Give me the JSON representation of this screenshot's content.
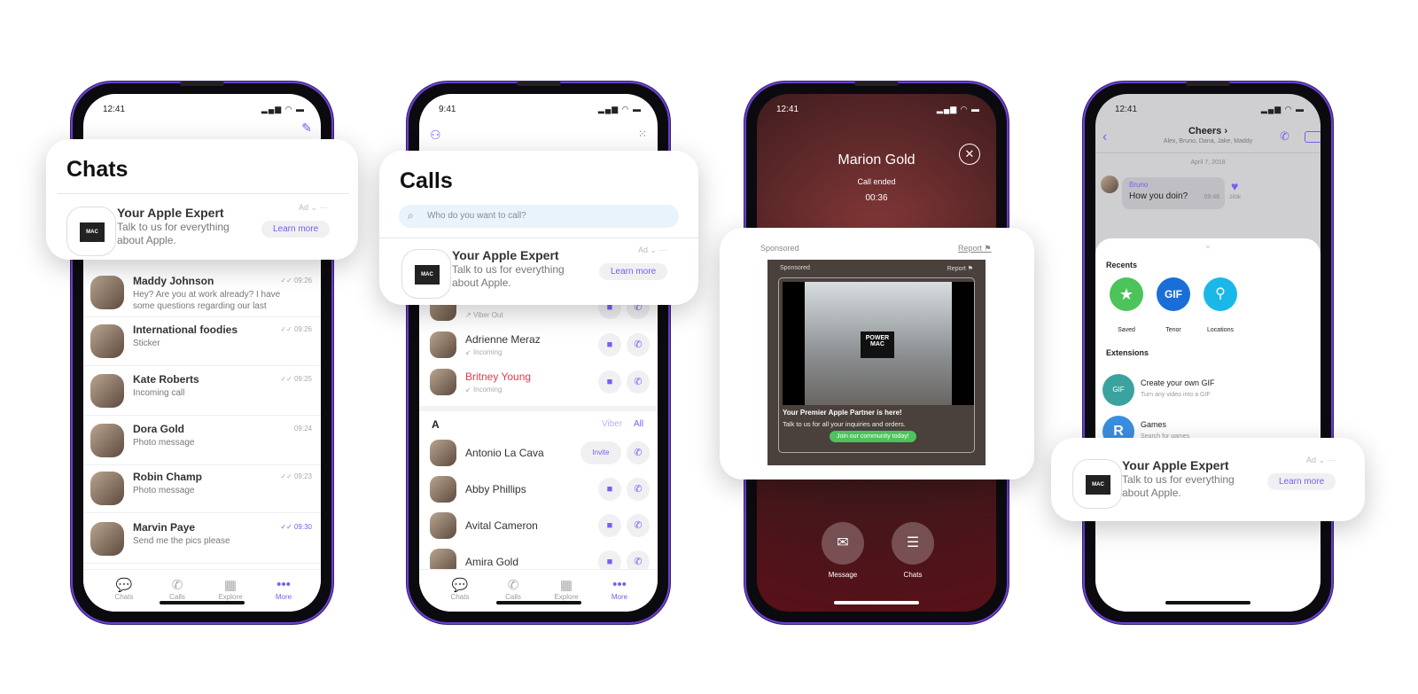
{
  "colors": {
    "accent": "#7360f2",
    "missed": "#e53950",
    "green": "#4cc35b"
  },
  "ad": {
    "title": "Your Apple Expert",
    "desc": "Talk to us for everything about Apple.",
    "cta": "Learn more",
    "ad_label": "Ad",
    "logo": "POWER MAC CENTER"
  },
  "chats": {
    "time": "12:41",
    "title": "Chats",
    "rows": [
      {
        "name": "Maddy Johnson",
        "msg": "Hey? Are you at work already? I have some questions regarding our last",
        "time": "09:26",
        "icon": "double-check-icon"
      },
      {
        "name": "International foodies",
        "msg": "Sticker",
        "time": "09:26",
        "icon": "check-icon"
      },
      {
        "name": "Kate Roberts",
        "msg": "Incoming call",
        "time": "09:25",
        "icon": "double-check-icon"
      },
      {
        "name": "Dora Gold",
        "msg": "Photo message",
        "time": "09:24",
        "icon": ""
      },
      {
        "name": "Robin Champ",
        "msg": "Photo message",
        "time": "09:23",
        "icon": "double-check-icon"
      },
      {
        "name": "Marvin Paye",
        "msg": "Send me the pics please",
        "time": "09:30",
        "icon": "double-check-icon"
      }
    ]
  },
  "tabs": [
    "Chats",
    "Calls",
    "Explore",
    "More"
  ],
  "calls": {
    "time": "9:41",
    "title": "Calls",
    "search_placeholder": "Who do you want to call?",
    "recent": [
      {
        "sub": "Viber Out"
      },
      {
        "name": "Adrienne Meraz",
        "sub": "Incoming"
      },
      {
        "name": "Britney Young",
        "sub": "Incoming"
      }
    ],
    "section": "A",
    "filter_viber": "Viber",
    "filter_all": "All",
    "invite": "Invite",
    "contacts": [
      "Antonio La Cava",
      "Abby Phillips",
      "Avital Cameron",
      "Amira Gold"
    ]
  },
  "call_ended": {
    "time": "12:41",
    "name": "Marion Gold",
    "status": "Call ended",
    "duration": "00:36",
    "sponsored": "Sponsored",
    "report": "Report",
    "ad_headline": "Your Premier Apple Partner is here!",
    "ad_text": "Talk to us for all your inquiries and orders.",
    "ad_cta": "Join our community today!",
    "message_label": "Message",
    "chats_label": "Chats"
  },
  "group": {
    "time": "12:41",
    "title": "Cheers",
    "members": "Alex, Bruno, Dana, Jake, Maddy",
    "date": "April 7, 2018",
    "sender": "Bruno",
    "message": "How you doin?",
    "msg_time": "09:48",
    "likes": "283k",
    "recents_label": "Recents",
    "recents": [
      "Saved",
      "Tenor",
      "Locations"
    ],
    "extensions_label": "Extensions",
    "ext": [
      {
        "title": "Create your own GIF",
        "sub": "Turn any video into a GIF"
      },
      {
        "title": "Games",
        "sub": "Search for games"
      }
    ]
  }
}
